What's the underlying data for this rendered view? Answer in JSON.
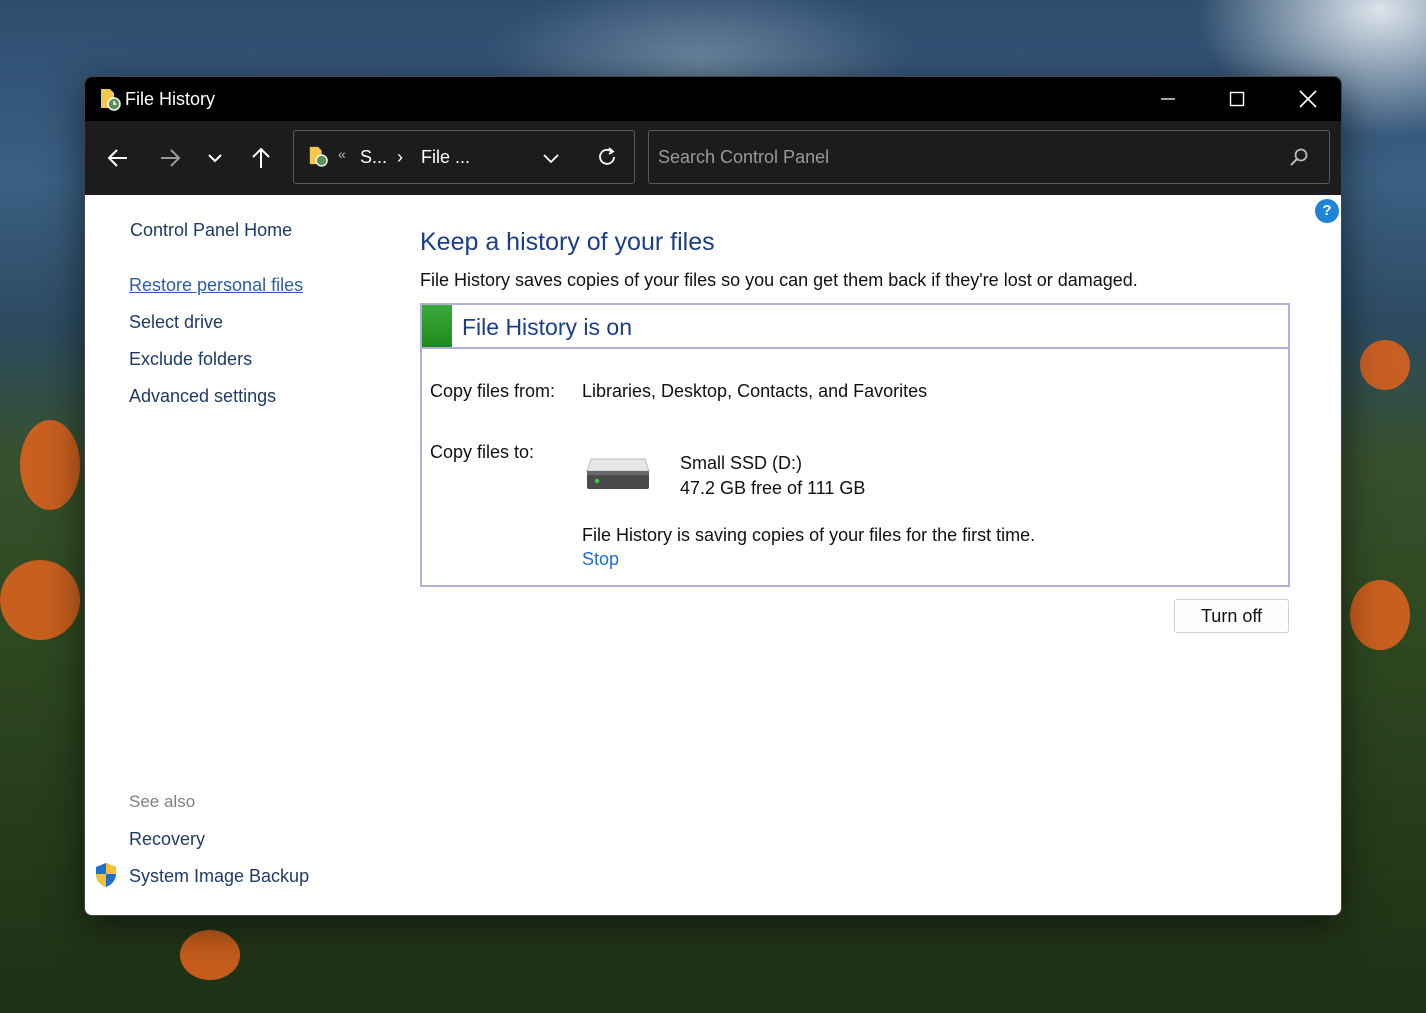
{
  "window": {
    "title": "File History"
  },
  "toolbar": {
    "breadcrumb_chevron": "«",
    "breadcrumb_segment1": "S...",
    "breadcrumb_separator": "›",
    "breadcrumb_segment2": "File ...",
    "search_placeholder": "Search Control Panel"
  },
  "sidebar": {
    "home": "Control Panel Home",
    "items": [
      {
        "label": "Restore personal files"
      },
      {
        "label": "Select drive"
      },
      {
        "label": "Exclude folders"
      },
      {
        "label": "Advanced settings"
      }
    ],
    "see_also_title": "See also",
    "see_also": [
      {
        "label": "Recovery"
      },
      {
        "label": "System Image Backup"
      }
    ]
  },
  "main": {
    "help_label": "?",
    "heading": "Keep a history of your files",
    "description": "File History saves copies of your files so you can get them back if they're lost or damaged.",
    "status": "File History is on",
    "copy_from_label": "Copy files from:",
    "copy_from_value": "Libraries, Desktop, Contacts, and Favorites",
    "copy_to_label": "Copy files to:",
    "drive_name": "Small SSD (D:)",
    "drive_space": "47.2 GB free of 111 GB",
    "progress_message": "File History is saving copies of your files for the first time.",
    "stop_label": "Stop",
    "turn_off_label": "Turn off"
  },
  "colors": {
    "status_on": "#2a9a2a",
    "link": "#1e6fd0",
    "heading": "#1b3d8a",
    "panel_border": "#b3b0d8"
  }
}
